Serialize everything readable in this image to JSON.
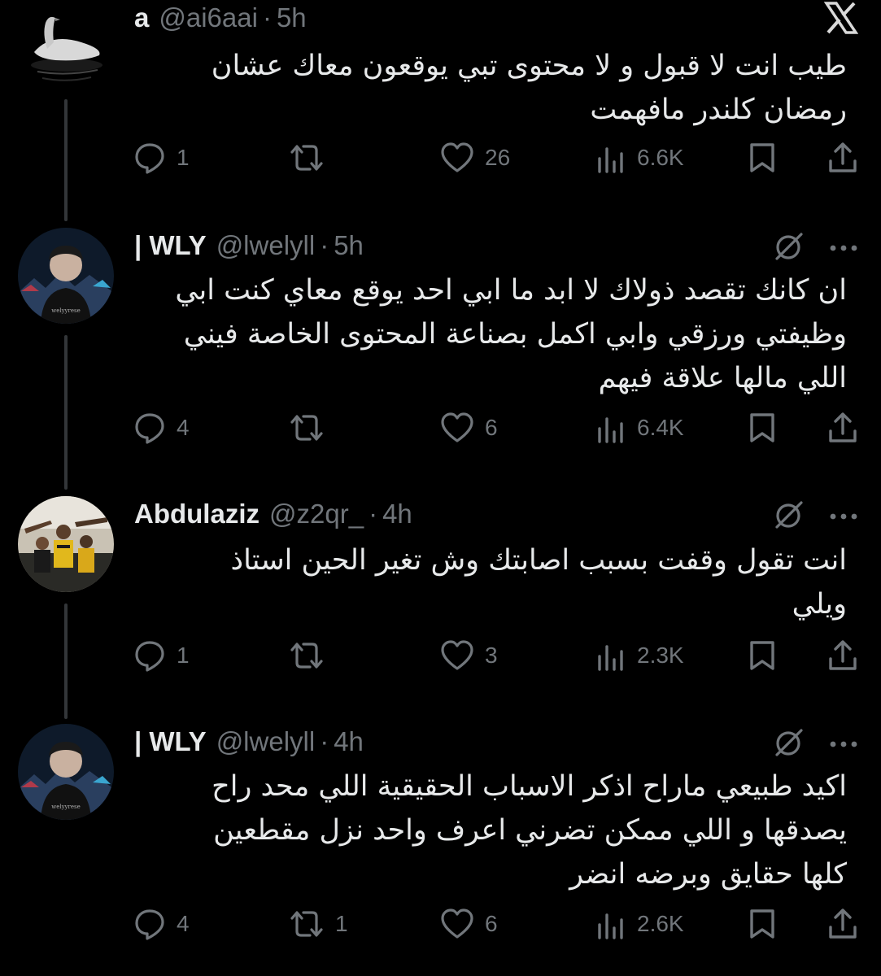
{
  "tweets": [
    {
      "display_name": "a",
      "handle": "@ai6aai",
      "separator": "·",
      "time": "5h",
      "text_lines": [
        "طيب انت لا قبول و لا محتوى تبي يوقعون معاك عشان",
        "رمضان كلندر مافهمت"
      ],
      "replies": "1",
      "retweets": "",
      "likes": "26",
      "views": "6.6K",
      "top_right_icon": "x-logo-icon",
      "avatar": "swan-icon"
    },
    {
      "display_name": "| WLY",
      "handle": "@lwelyll",
      "separator": "·",
      "time": "5h",
      "text_lines": [
        "ان كانك تقصد ذولاك لا ابد ما ابي احد يوقع معاي كنت ابي",
        "وظيفتي ورزقي وابي اكمل بصناعة المحتوى الخاصة فيني",
        "اللي مالها علاقة فيهم"
      ],
      "replies": "4",
      "retweets": "",
      "likes": "6",
      "views": "6.4K",
      "avatar": "profile-photo"
    },
    {
      "display_name": "Abdulaziz",
      "handle": "@z2qr_",
      "separator": "·",
      "time": "4h",
      "text_lines": [
        "انت تقول وقفت بسبب اصابتك وش تغير الحين استاذ",
        "ويلي"
      ],
      "replies": "1",
      "retweets": "",
      "likes": "3",
      "views": "2.3K",
      "avatar": "crowd-photo"
    },
    {
      "display_name": "| WLY",
      "handle": "@lwelyll",
      "separator": "·",
      "time": "4h",
      "text_lines": [
        "اكيد طبيعي ماراح اذكر الاسباب الحقيقية اللي محد راح",
        "يصدقها و اللي ممكن تضرني اعرف واحد نزل مقطعين",
        "كلها حقايق وبرضه انضر"
      ],
      "replies": "4",
      "retweets": "1",
      "likes": "6",
      "views": "2.6K",
      "avatar": "profile-photo"
    }
  ],
  "colors": {
    "background": "#000000",
    "text_primary": "#e7e9ea",
    "text_secondary": "#71767b",
    "thread_line": "#333639"
  }
}
